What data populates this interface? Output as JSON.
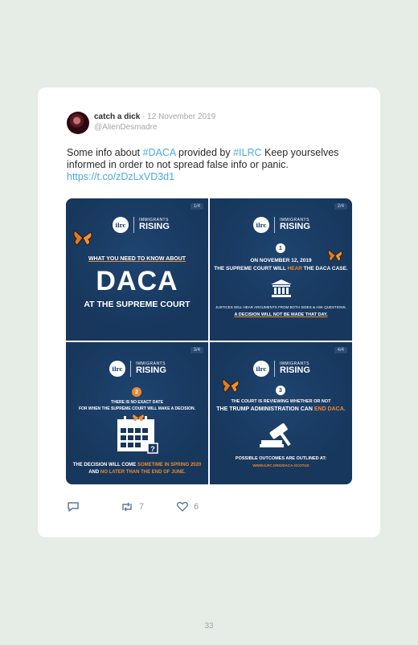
{
  "tweet": {
    "author_name": "catch a dick",
    "separator": "·",
    "date": "12 November 2019",
    "handle": "@AlienDesmadre",
    "text_1": "Some info about ",
    "hashtag_1": "#DACA",
    "text_2": " provided by ",
    "hashtag_2": "#ILRC",
    "text_3": " Keep yourselves informed in order to not spread false info or panic. ",
    "link": "https://t.co/zDzLxVD3d1"
  },
  "logo": {
    "circle": "ilrc",
    "line1": "IMMIGRANTS",
    "line2": "RISING"
  },
  "panels": [
    {
      "num": "1/4",
      "heading": "WHAT YOU NEED TO KNOW ABOUT",
      "big": "DACA",
      "sub": "AT THE SUPREME COURT"
    },
    {
      "num": "2/4",
      "badge": "1",
      "line1": "ON NOVEMBER 12, 2019",
      "line2a": "THE SUPREME COURT WILL ",
      "line2b": "HEAR",
      "line2c": " THE DACA CASE.",
      "small1": "JUSTICES WILL HEAR ARGUMENTS FROM BOTH SIDES & ASK QUESTIONS.",
      "small2": "A DECISION WILL NOT BE MADE THAT DAY."
    },
    {
      "num": "3/4",
      "badge": "2",
      "line1": "THERE IS NO EXACT DATE",
      "line2": "FOR WHEN THE SUPREME COURT WILL MAKE A DECISION.",
      "bottom1a": "THE DECISION WILL COME ",
      "bottom1b": "SOMETIME IN SPRING 2020",
      "bottom2a": "AND ",
      "bottom2b": "NO LATER THAN THE END OF JUNE."
    },
    {
      "num": "4/4",
      "badge": "3",
      "line1": "THE COURT IS REVIEWING WHETHER OR NOT",
      "line2a": "THE TRUMP ADMINISTRATION CAN ",
      "line2b": "END DACA.",
      "line3": "POSSIBLE OUTCOMES ARE OUTLINED AT:",
      "url": "WWW.ILRC.ORG/DACA-SCOTUS"
    }
  ],
  "actions": {
    "reply_icon": "reply-icon",
    "retweet_count": "7",
    "like_count": "6"
  },
  "page_number": "33",
  "colors": {
    "panel_bg": "#17375c",
    "accent": "#f08a2c",
    "link": "#4aa9e0"
  }
}
